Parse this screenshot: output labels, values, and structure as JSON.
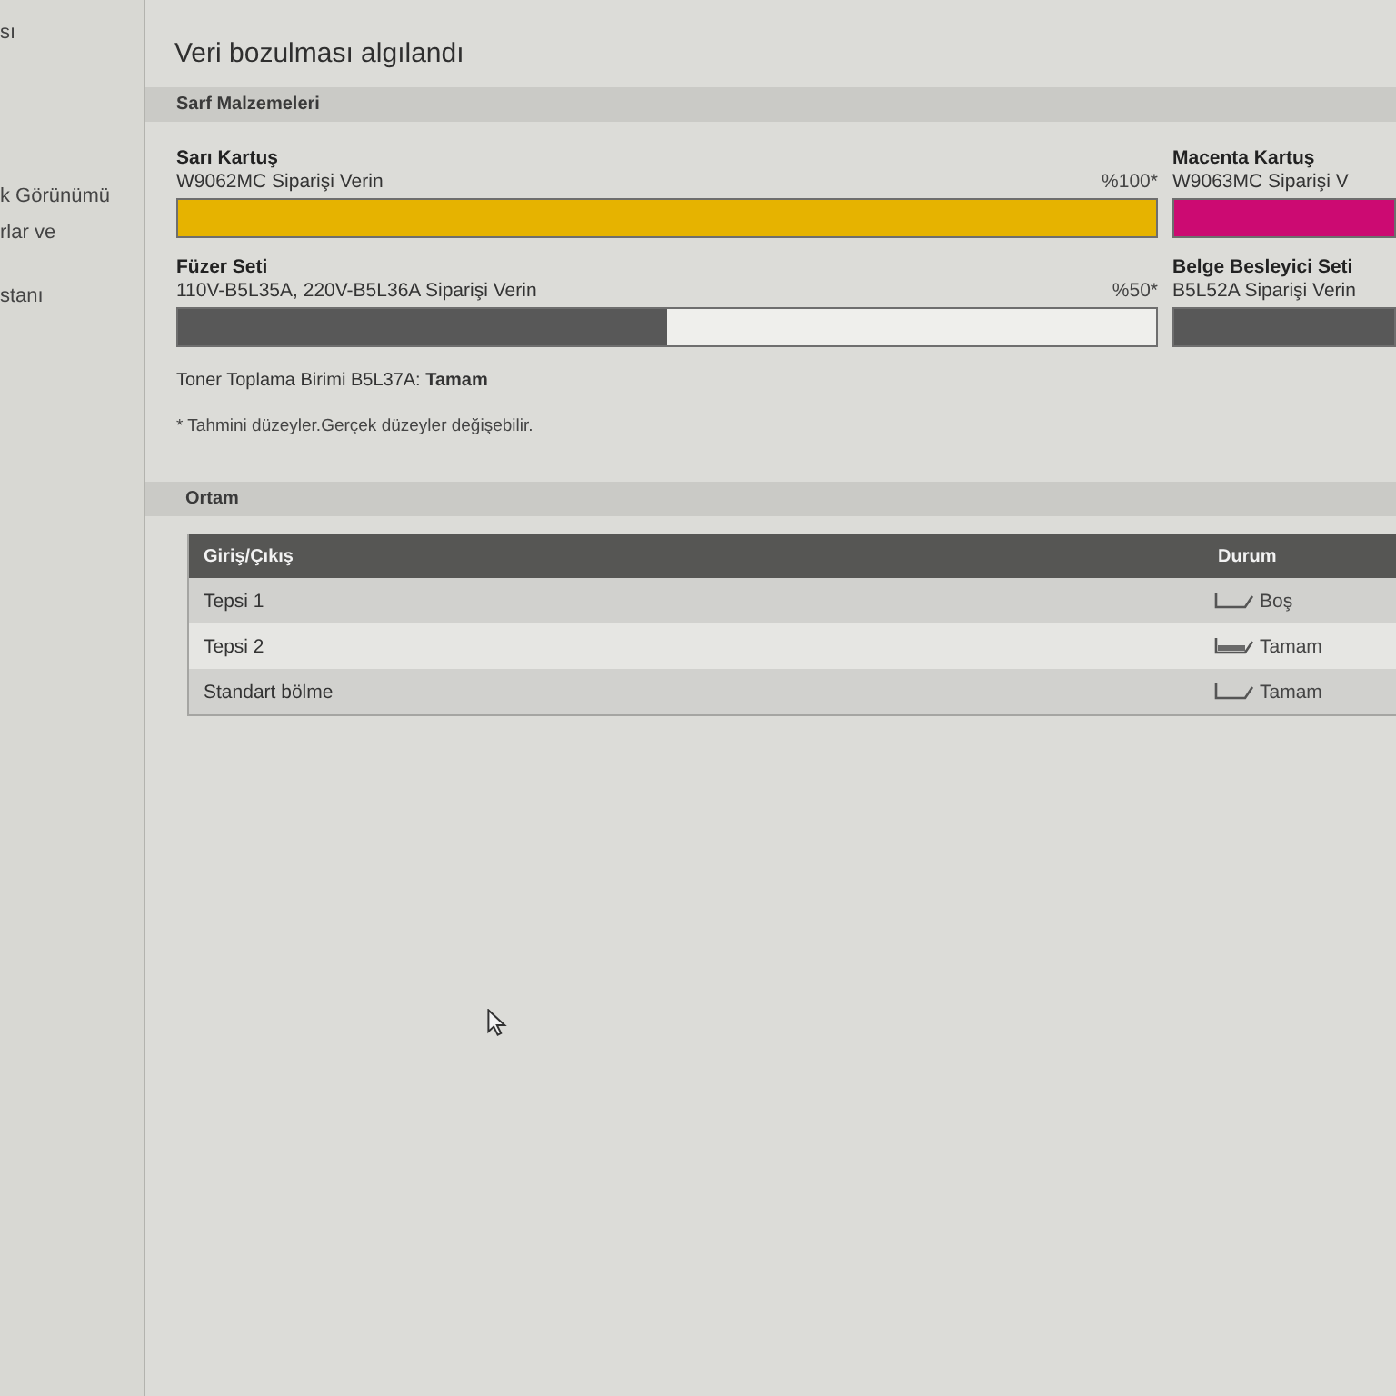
{
  "sidebar": {
    "items": [
      "sı",
      "k Görünümü",
      "rlar ve",
      "stanı"
    ]
  },
  "title": "Veri bozulması algılandı",
  "supplies_section": {
    "heading": "Sarf Malzemeleri",
    "items": [
      {
        "name": "Sarı Kartuş",
        "order": "W9062MC Siparişi Verin",
        "percent": "%100*",
        "level": 1,
        "color": "#e6b300"
      },
      {
        "name": "Macenta Kartuş",
        "order": "W9063MC Siparişi V",
        "level": 1,
        "color": "#cc0a72"
      },
      {
        "name": "Füzer Seti",
        "order": "110V-B5L35A, 220V-B5L36A Siparişi Verin",
        "percent": "%50*",
        "level": 0.5,
        "color": "#585858"
      },
      {
        "name": "Belge Besleyici Seti",
        "order": "B5L52A Siparişi Verin",
        "level": 1,
        "color": "#585858"
      }
    ],
    "collection_unit": "Toner Toplama Birimi B5L37A: **Tamam**",
    "note": "* Tahmini düzeyler.Gerçek düzeyler değişebilir."
  },
  "media_section": {
    "heading": "Ortam",
    "columns": [
      "Giriş/Çıkış",
      "Durum"
    ],
    "rows": [
      {
        "name": "Tepsi 1",
        "status": "Boş",
        "tray_filled": false
      },
      {
        "name": "Tepsi 2",
        "status": "Tamam",
        "tray_filled": true
      },
      {
        "name": "Standart bölme",
        "status": "Tamam",
        "tray_filled": false
      }
    ]
  }
}
